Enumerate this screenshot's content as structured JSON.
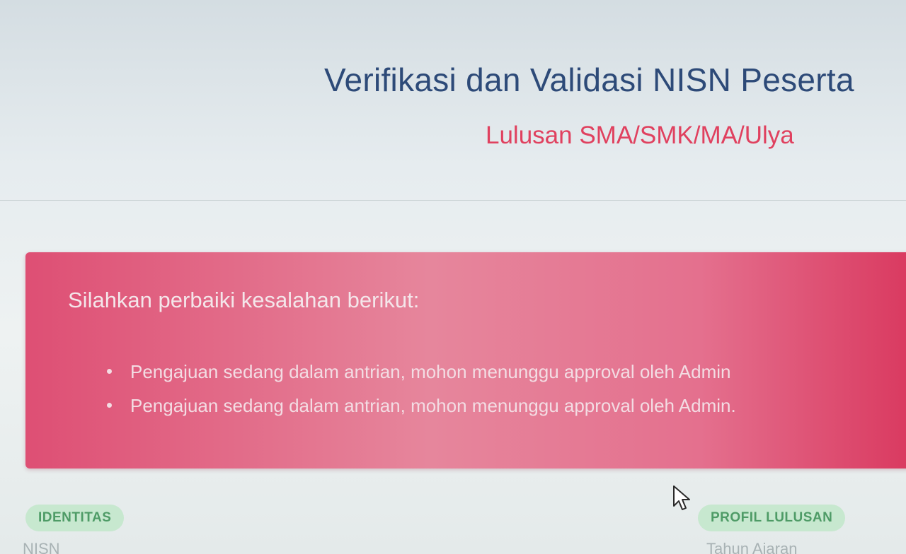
{
  "header": {
    "title": "Verifikasi dan Validasi NISN Peserta",
    "subtitle": "Lulusan SMA/SMK/MA/Ulya"
  },
  "alert": {
    "heading": "Silahkan perbaiki kesalahan berikut:",
    "items": [
      "Pengajuan sedang dalam antrian, mohon menunggu approval oleh Admin",
      "Pengajuan sedang dalam antrian, mohon menunggu approval oleh Admin."
    ],
    "color": "#e0567a"
  },
  "sections": {
    "identitas_label": "IDENTITAS",
    "profil_lulusan_label": "PROFIL LULUSAN"
  },
  "fields": {
    "left_label": "NISN",
    "right_label": "Tahun Ajaran"
  },
  "icons": {
    "cursor": "mouse-pointer-icon"
  }
}
